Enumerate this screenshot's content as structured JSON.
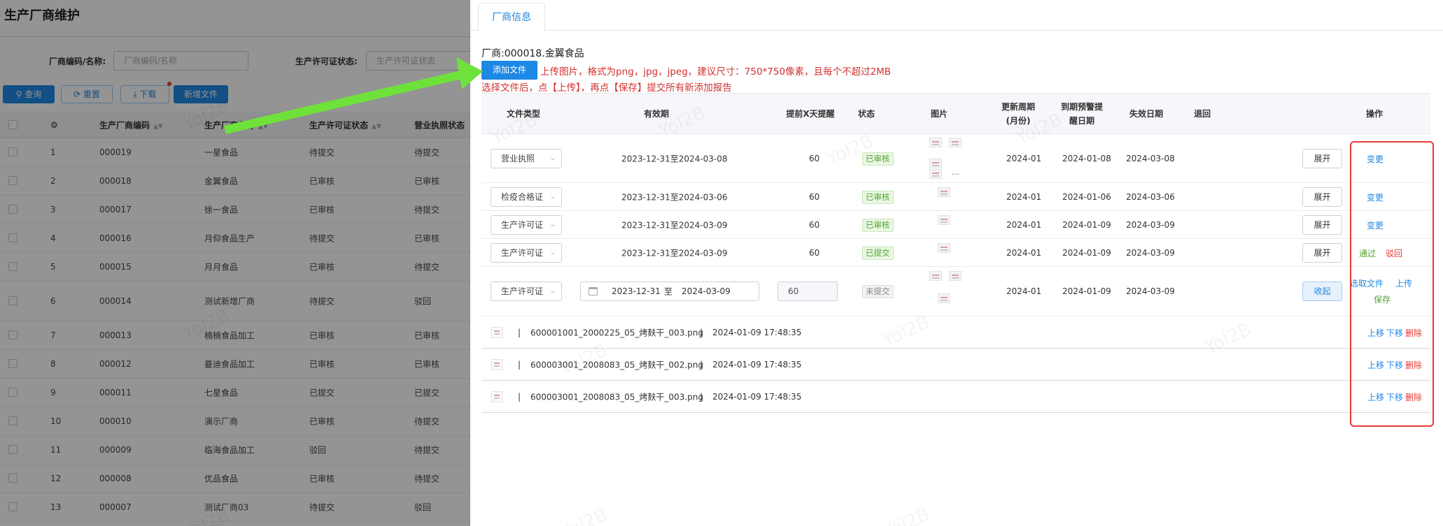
{
  "background_page": {
    "title": "生产厂商维护",
    "filters": [
      {
        "label": "厂商编码/名称:",
        "placeholder": "厂商编码/名称"
      },
      {
        "label": "生产许可证状态:",
        "placeholder": "生产许可证状态"
      }
    ],
    "buttons": {
      "query": "查询",
      "reset": "重置",
      "download": "下载",
      "add": "新增文件"
    },
    "table": {
      "headers": [
        "生产厂商编码",
        "生产厂商名称",
        "生产许可证状态",
        "营业执照状态"
      ],
      "rows": [
        {
          "no": "1",
          "code": "000019",
          "name": "一星食品",
          "license": "待提交",
          "business": "待提交"
        },
        {
          "no": "2",
          "code": "000018",
          "name": "金翼食品",
          "license": "已审核",
          "business": "已审核"
        },
        {
          "no": "3",
          "code": "000017",
          "name": "徐一食品",
          "license": "已审核",
          "business": "待提交"
        },
        {
          "no": "4",
          "code": "000016",
          "name": "月仰食品生产",
          "license": "待提交",
          "business": "已审核"
        },
        {
          "no": "5",
          "code": "000015",
          "name": "月月食品",
          "license": "已审核",
          "business": "待提交"
        },
        {
          "no": "6",
          "code": "000014",
          "name": "测试新增厂商",
          "license": "待提交",
          "business": "驳回"
        },
        {
          "no": "7",
          "code": "000013",
          "name": "楠楠食品加工",
          "license": "已审核",
          "business": "已审核"
        },
        {
          "no": "8",
          "code": "000012",
          "name": "曼迪食品加工",
          "license": "已审核",
          "business": "已审核"
        },
        {
          "no": "9",
          "code": "000011",
          "name": "七星食品",
          "license": "已提交",
          "business": "已提交"
        },
        {
          "no": "10",
          "code": "000010",
          "name": "演示厂商",
          "license": "已审核",
          "business": "待提交"
        },
        {
          "no": "11",
          "code": "000009",
          "name": "临海食品加工",
          "license": "驳回",
          "business": "待提交"
        },
        {
          "no": "12",
          "code": "000008",
          "name": "优品食品",
          "license": "已审核",
          "business": "待提交"
        },
        {
          "no": "13",
          "code": "000007",
          "name": "测试厂商03",
          "license": "待提交",
          "business": "驳回"
        }
      ]
    }
  },
  "drawer": {
    "tab": "厂商信息",
    "vendor": "厂商:000018.金翼食品",
    "add_file_button": "添加文件",
    "note1": "上传图片，格式为png，jpg，jpeg，建议尺寸：750*750像素，且每个不超过2MB",
    "note2": "选择文件后，点【上传】，再点【保存】提交所有新添加报告",
    "headers": {
      "type": "文件类型",
      "validity": "有效期",
      "remind": "提前X天提醒",
      "status": "状态",
      "image": "图片",
      "cycle": "更新周期(月份)",
      "warn": "到期预警提醒日期",
      "expire": "失效日期",
      "reject": "退回",
      "ops": "操作"
    },
    "rows": [
      {
        "type": "营业执照",
        "validity": "2023-12-31至2024-03-08",
        "remind": "60",
        "status": "已审核",
        "cycle": "2024-01",
        "warn": "2024-01-08",
        "expire": "2024-03-08",
        "toggle": "展开",
        "op1": "变更"
      },
      {
        "type": "检疫合格证",
        "validity": "2023-12-31至2024-03-06",
        "remind": "60",
        "status": "已审核",
        "cycle": "2024-01",
        "warn": "2024-01-06",
        "expire": "2024-03-06",
        "toggle": "展开",
        "op1": "变更"
      },
      {
        "type": "生产许可证",
        "validity": "2023-12-31至2024-03-09",
        "remind": "60",
        "status": "已审核",
        "cycle": "2024-01",
        "warn": "2024-01-09",
        "expire": "2024-03-09",
        "toggle": "展开",
        "op1": "变更"
      },
      {
        "type": "生产许可证",
        "validity": "2023-12-31至2024-03-09",
        "remind": "60",
        "status": "已提交",
        "cycle": "2024-01",
        "warn": "2024-01-09",
        "expire": "2024-03-09",
        "toggle": "展开",
        "op1": "通过",
        "op2": "驳回"
      }
    ],
    "edit_row": {
      "type": "生产许可证",
      "start": "2023-12-31",
      "sep": "至",
      "end": "2024-03-09",
      "remind": "60",
      "status": "未提交",
      "cycle": "2024-01",
      "warn": "2024-01-09",
      "expire": "2024-03-09",
      "toggle": "收起",
      "op_select": "选取文件",
      "op_upload": "上传",
      "op_save": "保存"
    },
    "files": [
      {
        "name": "600001001_2000225_05_烤麸干_003.png",
        "time": "2024-01-09 17:48:35"
      },
      {
        "name": "600003001_2008083_05_烤麸干_002.png",
        "time": "2024-01-09 17:48:35"
      },
      {
        "name": "600003001_2008083_05_烤麸干_003.png",
        "time": "2024-01-09 17:48:35"
      }
    ],
    "file_ops": {
      "up": "上移",
      "down": "下移",
      "delete": "删除"
    },
    "divider": "|"
  },
  "colors": {
    "primary": "#1e88e5",
    "danger": "#e53935",
    "success": "#52a431",
    "arrow": "#6ee23a"
  },
  "icons": [
    "search-icon",
    "refresh-icon",
    "download-icon",
    "settings-icon",
    "calendar-icon",
    "chevron-down-icon",
    "sort-icon"
  ]
}
